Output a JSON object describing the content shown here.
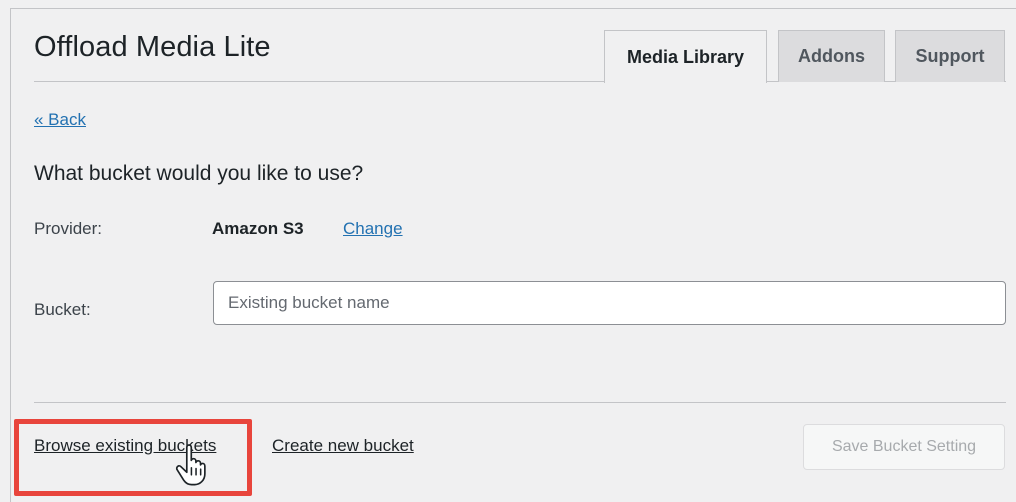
{
  "header": {
    "title": "Offload Media Lite",
    "tabs": [
      {
        "label": "Media Library",
        "active": true
      },
      {
        "label": "Addons",
        "active": false
      },
      {
        "label": "Support",
        "active": false
      }
    ]
  },
  "main": {
    "back_label": "« Back",
    "question": "What bucket would you like to use?",
    "provider": {
      "label": "Provider:",
      "value": "Amazon S3",
      "change_label": "Change"
    },
    "bucket": {
      "label": "Bucket:",
      "value": "",
      "placeholder": "Existing bucket name"
    }
  },
  "footer": {
    "browse_label": "Browse existing buckets",
    "create_label": "Create new bucket",
    "save_label": "Save Bucket Setting"
  },
  "colors": {
    "link": "#2271b1",
    "highlight": "#e8453c",
    "background": "#f0f0f1"
  },
  "icons": {
    "cursor": "hand-pointer-icon"
  }
}
